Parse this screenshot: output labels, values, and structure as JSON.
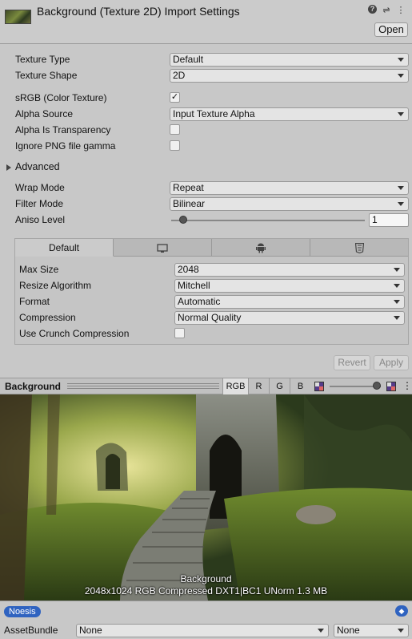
{
  "header": {
    "title": "Background (Texture 2D) Import Settings",
    "open_label": "Open",
    "icons": [
      "help-icon",
      "sliders-icon",
      "more-icon"
    ]
  },
  "settings": {
    "texture_type": {
      "label": "Texture Type",
      "value": "Default"
    },
    "texture_shape": {
      "label": "Texture Shape",
      "value": "2D"
    },
    "srgb": {
      "label": "sRGB (Color Texture)",
      "checked": true,
      "check_glyph": "✓"
    },
    "alpha_source": {
      "label": "Alpha Source",
      "value": "Input Texture Alpha"
    },
    "alpha_is_transparency": {
      "label": "Alpha Is Transparency",
      "checked": false
    },
    "ignore_png_gamma": {
      "label": "Ignore PNG file gamma",
      "checked": false
    },
    "advanced": {
      "label": "Advanced"
    },
    "wrap_mode": {
      "label": "Wrap Mode",
      "value": "Repeat"
    },
    "filter_mode": {
      "label": "Filter Mode",
      "value": "Bilinear"
    },
    "aniso_level": {
      "label": "Aniso Level",
      "value": "1",
      "slider_fraction": 0.06
    }
  },
  "platform": {
    "tabs": [
      {
        "label": "Default",
        "icon": ""
      },
      {
        "label": "",
        "icon": "monitor-icon"
      },
      {
        "label": "",
        "icon": "android-icon"
      },
      {
        "label": "",
        "icon": "html5-icon"
      }
    ],
    "max_size": {
      "label": "Max Size",
      "value": "2048"
    },
    "resize_algorithm": {
      "label": "Resize Algorithm",
      "value": "Mitchell"
    },
    "format": {
      "label": "Format",
      "value": "Automatic"
    },
    "compression": {
      "label": "Compression",
      "value": "Normal Quality"
    },
    "crunch": {
      "label": "Use Crunch Compression",
      "checked": false
    }
  },
  "actions": {
    "revert": "Revert",
    "apply": "Apply"
  },
  "preview": {
    "title": "Background",
    "channels": [
      "RGB",
      "R",
      "G",
      "B"
    ],
    "active_channel": "RGB",
    "mip_fraction": 0.92,
    "caption_name": "Background",
    "caption_info": "2048x1024  RGB Compressed DXT1|BC1 UNorm   1.3 MB"
  },
  "footer": {
    "badge": "Noesis",
    "assetbundle_label": "AssetBundle",
    "assetbundle_name": "None",
    "assetbundle_variant": "None"
  }
}
